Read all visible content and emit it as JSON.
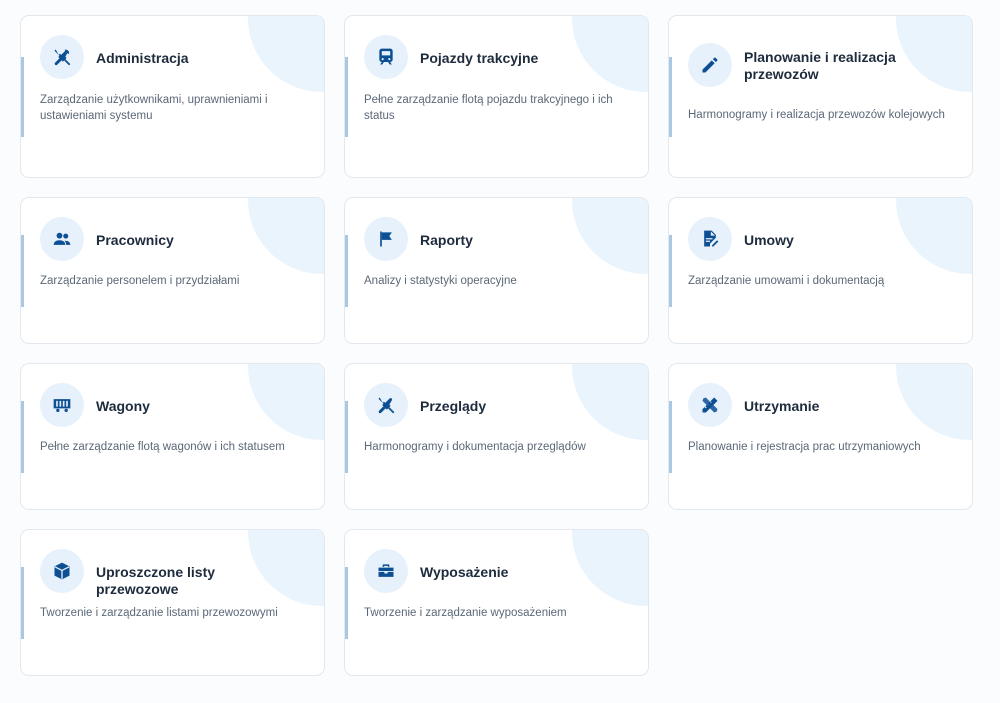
{
  "colors": {
    "icon": "#0d4f93",
    "icon_bg": "#e6f1fb",
    "accent_bar": "#a8c8e4",
    "title": "#1d2b3c",
    "description": "#5b6878"
  },
  "cards": [
    {
      "title": "Administracja",
      "description": "Zarządzanie użytkownikami, uprawnieniami i ustawieniami systemu",
      "icon": "tools-icon"
    },
    {
      "title": "Pojazdy trakcyjne",
      "description": "Pełne zarządzanie flotą pojazdu trakcyjnego i ich status",
      "icon": "train-icon"
    },
    {
      "title": "Planowanie i realizacja przewozów",
      "description": "Harmonogramy i realizacja przewozów kolejowych",
      "icon": "pencil-icon"
    },
    {
      "title": "Pracownicy",
      "description": "Zarządzanie personelem i przydziałami",
      "icon": "users-icon"
    },
    {
      "title": "Raporty",
      "description": "Analizy i statystyki operacyjne",
      "icon": "flag-icon"
    },
    {
      "title": "Umowy",
      "description": "Zarządzanie umowami i dokumentacją",
      "icon": "signed-document-icon"
    },
    {
      "title": "Wagony",
      "description": "Pełne zarządzanie flotą wagonów i ich statusem",
      "icon": "wagon-icon"
    },
    {
      "title": "Przeglądy",
      "description": "Harmonogramy i dokumentacja przeglądów",
      "icon": "wrench-screwdriver-icon"
    },
    {
      "title": "Utrzymanie",
      "description": "Planowanie i rejestracja prac utrzymaniowych",
      "icon": "ruler-pencil-icon"
    },
    {
      "title": "Uproszczone listy przewozowe",
      "description": "Tworzenie i zarządzanie listami przewozowymi",
      "icon": "box-icon"
    },
    {
      "title": "Wyposażenie",
      "description": "Tworzenie i zarządzanie wyposażeniem",
      "icon": "toolbox-icon"
    }
  ]
}
